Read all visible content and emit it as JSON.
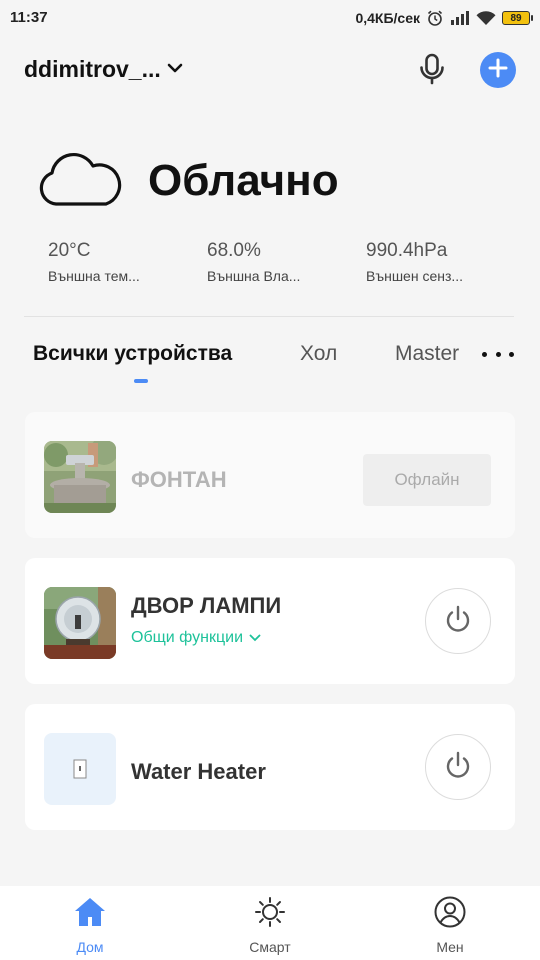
{
  "status_bar": {
    "time": "11:37",
    "network_speed": "0,4КБ/сек",
    "battery": "89",
    "icons": [
      "alarm-icon",
      "signal-icon",
      "wifi-icon",
      "battery-icon"
    ]
  },
  "header": {
    "home_name": "ddimitrov_...",
    "icons": [
      "chevron-down-icon",
      "microphone-icon",
      "add-icon"
    ],
    "accent_color": "#4c8bf5"
  },
  "weather": {
    "condition": "Облачно",
    "icon": "cloud-icon",
    "stats": [
      {
        "value": "20°C",
        "label": "Външна тем..."
      },
      {
        "value": "68.0%",
        "label": "Външна Вла..."
      },
      {
        "value": "990.4hPa",
        "label": "Външен сенз..."
      }
    ]
  },
  "tabs": {
    "items": [
      "Всички устройства",
      "Хол",
      "Master"
    ],
    "active": "Всички устройства",
    "more_icon": "more-dots-icon"
  },
  "devices": [
    {
      "name": "ФОНТАН",
      "status": "Офлайн",
      "thumb": "fountain-photo"
    },
    {
      "name": "ДВОР ЛАМПИ",
      "functions_label": "Общи функции",
      "thumb": "garden-lamp-photo",
      "power_icon": "power-icon"
    },
    {
      "name": "Water Heater",
      "thumb": "switch-device-icon",
      "power_icon": "power-icon"
    }
  ],
  "function_link_color": "#1ec29a",
  "bottom_nav": {
    "items": [
      {
        "label": "Дом",
        "icon": "home-icon",
        "active": true
      },
      {
        "label": "Смарт",
        "icon": "sun-icon",
        "active": false
      },
      {
        "label": "Мен",
        "icon": "profile-icon",
        "active": false
      }
    ]
  }
}
